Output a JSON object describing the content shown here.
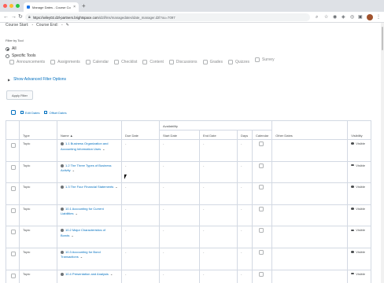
{
  "browser": {
    "tab_title": "Manage Dates - Course Copy",
    "tab_close": "×",
    "new_tab": "+",
    "url_host": "https://wiley02.d2l-partners.brightspace.com",
    "url_path": "/d2l/lms/managedates/date_manager.d2l?ou=7097",
    "traffic_colors": [
      "#ff5f57",
      "#febc2e",
      "#28c840"
    ]
  },
  "header": {
    "course_start": "Course Start:",
    "course_start_value": "-",
    "course_end": "Course End:",
    "course_end_value": "-"
  },
  "filter": {
    "label": "Filter by Tool",
    "all": "All",
    "specific": "Specific Tools",
    "tools": [
      "Announcements",
      "Assignments",
      "Calendar",
      "Checklist",
      "Content",
      "Discussions",
      "Grades",
      "Quizzes",
      "Survey"
    ],
    "advanced": "Show Advanced Filter Options",
    "apply": "Apply Filter"
  },
  "actions": {
    "edit": "Edit Dates",
    "offset": "Offset Dates"
  },
  "table": {
    "headers": {
      "type": "Type",
      "name": "Name ▲",
      "due": "Due Date",
      "availability": "Availability",
      "start": "Start Date",
      "end": "End Date",
      "days": "Days",
      "calendar": "Calendar",
      "other": "Other Dates",
      "visibility": "Visibility"
    },
    "rows": [
      {
        "type": "Topic",
        "name": "1.1 Business Organization and Accounting Information Uses",
        "due": "-",
        "start": "-",
        "end": "-",
        "days": "-",
        "visibility": "Visible"
      },
      {
        "type": "Topic",
        "name": "1.2 The Three Types of Business Activity",
        "due": "-",
        "start": "-",
        "end": "-",
        "days": "-",
        "visibility": "Visible"
      },
      {
        "type": "Topic",
        "name": "1.3 The Four Financial Statements",
        "due": "-",
        "start": "-",
        "end": "-",
        "days": "-",
        "visibility": "Visible"
      },
      {
        "type": "Topic",
        "name": "10.1 Accounting for Current Liabilities",
        "due": "-",
        "start": "-",
        "end": "-",
        "days": "-",
        "visibility": "Visible"
      },
      {
        "type": "Topic",
        "name": "10.2 Major Characteristics of Bonds",
        "due": "-",
        "start": "-",
        "end": "-",
        "days": "-",
        "visibility": "Visible"
      },
      {
        "type": "Topic",
        "name": "10.3 Accounting for Bond Transactions",
        "due": "-",
        "start": "-",
        "end": "-",
        "days": "-",
        "visibility": "Visible"
      },
      {
        "type": "Topic",
        "name": "10.4 Presentation and Analysis",
        "due": "-",
        "start": "-",
        "end": "-",
        "days": "-",
        "visibility": "Visible"
      }
    ]
  }
}
